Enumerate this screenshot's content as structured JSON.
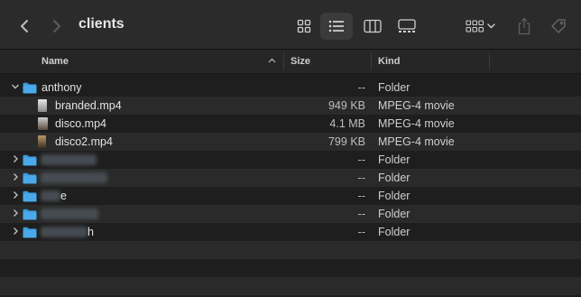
{
  "window": {
    "title": "clients"
  },
  "toolbar": {
    "icons": [
      "back-chevron-icon",
      "forward-chevron-icon",
      "icon-view-icon",
      "list-view-icon",
      "column-view-icon",
      "gallery-view-icon",
      "group-icon",
      "share-icon",
      "tag-icon"
    ]
  },
  "columns": {
    "name": "Name",
    "size": "Size",
    "kind": "Kind"
  },
  "rows": [
    {
      "name": "anthony",
      "size": "",
      "kind": "",
      "type": "folder-open"
    },
    {
      "name": "branded.mp4",
      "size": "949 KB",
      "kind": "MPEG-4 movie",
      "type": "file"
    },
    {
      "name": "disco.mp4",
      "size": "4.1 MB",
      "kind": "MPEG-4 movie",
      "type": "file"
    },
    {
      "name": "disco2.mp4",
      "size": "799 KB",
      "kind": "MPEG-4 movie",
      "type": "file"
    },
    {
      "name": "",
      "size": "--",
      "kind": "Folder",
      "type": "folder-blurred"
    },
    {
      "name": "",
      "size": "--",
      "kind": "Folder",
      "type": "folder-blurred"
    },
    {
      "name": "e",
      "size": "--",
      "kind": "Folder",
      "type": "folder-blurred"
    },
    {
      "name": "",
      "size": "--",
      "kind": "Folder",
      "type": "folder-blurred"
    },
    {
      "name": "h",
      "size": "--",
      "kind": "Folder",
      "type": "folder-blurred"
    }
  ],
  "folder_placeholder": {
    "size": "--",
    "kind": "Folder"
  },
  "colors": {
    "folder": "#3a9bdc",
    "background": "#1e1e1e",
    "alt_row": "#2a2a2a"
  }
}
